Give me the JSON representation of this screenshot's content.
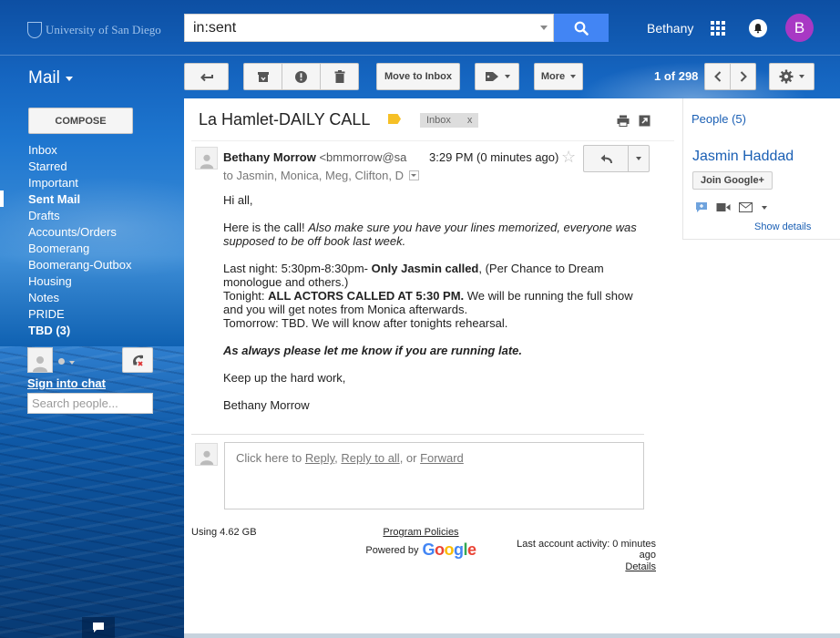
{
  "header": {
    "logo_text": "University of San Diego",
    "search_value": "in:sent",
    "user_name": "Bethany",
    "avatar_letter": "B"
  },
  "toolbar": {
    "mail_label": "Mail",
    "move_to_inbox": "Move to Inbox",
    "more": "More",
    "pager": "1 of 298"
  },
  "sidebar": {
    "compose": "COMPOSE",
    "items": [
      {
        "label": "Inbox",
        "bold": false
      },
      {
        "label": "Starred",
        "bold": false
      },
      {
        "label": "Important",
        "bold": false
      },
      {
        "label": "Sent Mail",
        "bold": true
      },
      {
        "label": "Drafts",
        "bold": false
      },
      {
        "label": "Accounts/Orders",
        "bold": false
      },
      {
        "label": "Boomerang",
        "bold": false
      },
      {
        "label": "Boomerang-Outbox",
        "bold": false
      },
      {
        "label": "Housing",
        "bold": false
      },
      {
        "label": "Notes",
        "bold": false
      },
      {
        "label": "PRIDE",
        "bold": false
      },
      {
        "label": "TBD (3)",
        "bold": true
      }
    ],
    "sign_into_chat": "Sign into chat",
    "search_people_placeholder": "Search people..."
  },
  "message": {
    "subject": "La Hamlet-DAILY CALL",
    "label_chip": "Inbox",
    "label_chip_close": "x",
    "sender_name": "Bethany Morrow",
    "sender_addr": "<bmmorrow@sandiego.edu>",
    "time": "3:29 PM (0 minutes ago)",
    "recipients": "to Jasmin, Monica, Meg, Clifton, D",
    "body": {
      "greeting": "Hi all,",
      "p1_plain": "Here is the call! ",
      "p1_italic": "Also make sure you have your lines memorized, everyone was supposed to be off book last week.",
      "last_night_a": "Last night: 5:30pm-8:30pm- ",
      "last_night_b": "Only Jasmin called",
      "last_night_c": ", (Per Chance to Dream monologue and others.)",
      "tonight_a": "Tonight: ",
      "tonight_b": "ALL ACTORS CALLED AT 5:30 PM.",
      "tonight_c": " We will be running the full show and you will get notes from Monica afterwards.",
      "tomorrow": "Tomorrow: TBD. We will know after tonights rehearsal.",
      "late_note": "As always please let me know if you are running late.",
      "keep_up": "Keep up the hard work,",
      "signoff": "Bethany Morrow"
    },
    "reply_prefix": "Click here to ",
    "reply_link": "Reply",
    "reply_sep1": ", ",
    "reply_all_link": "Reply to all",
    "reply_sep2": ", or ",
    "forward_link": "Forward"
  },
  "footer": {
    "usage": "Using 4.62 GB",
    "program_policies": "Program Policies",
    "powered_by": "Powered by",
    "google": "Google",
    "last_activity": "Last account activity: 0 minutes ago",
    "details": "Details"
  },
  "people_panel": {
    "heading": "People (5)",
    "contact_name": "Jasmin Haddad",
    "join_button": "Join Google+",
    "show_details": "Show details"
  },
  "colors": {
    "accent_blue": "#4285f4",
    "link_blue": "#1a5fb4",
    "avatar_purple": "#a838c4",
    "label_yellow": "#f6c026"
  }
}
